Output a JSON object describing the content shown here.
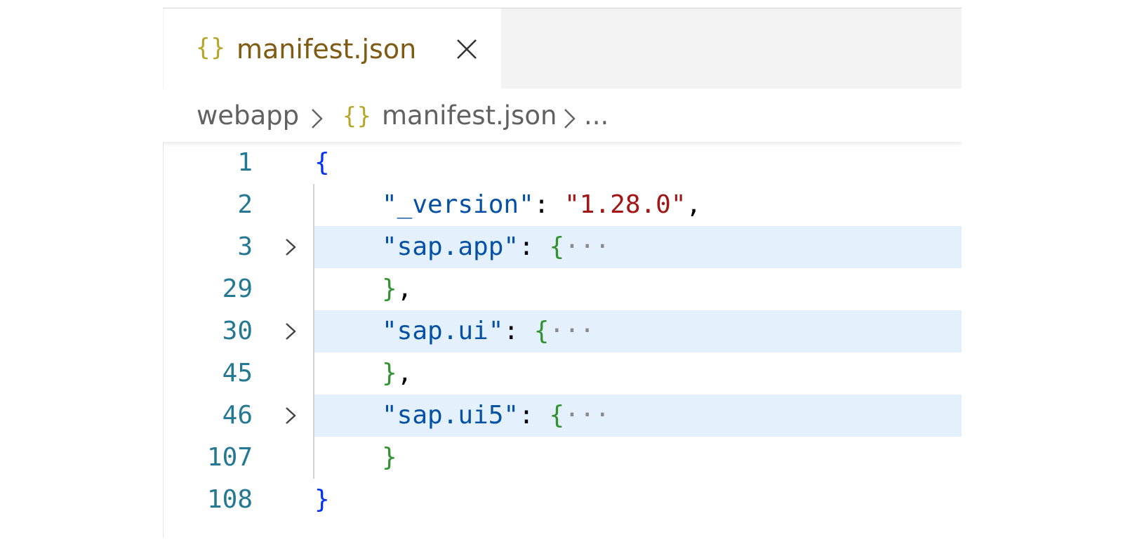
{
  "tab": {
    "icon": "json-braces-icon",
    "icon_text": "{}",
    "label": "manifest.json",
    "close_icon": "close-icon"
  },
  "breadcrumb": {
    "folder": "webapp",
    "file_icon_text": "{}",
    "file": "manifest.json",
    "more": "..."
  },
  "colors": {
    "line_number": "#237893",
    "key": "#0451a5",
    "string": "#a31515",
    "brace_level1": "#0431fa",
    "brace_level2": "#319331",
    "fold_highlight": "#e5f0fd"
  },
  "code": {
    "lines": [
      {
        "number": "1",
        "foldable": false,
        "tokens": {
          "open": "{"
        }
      },
      {
        "number": "2",
        "foldable": false,
        "tokens": {
          "key": "\"_version\"",
          "colon": ":",
          "value": "\"1.28.0\"",
          "comma": ","
        }
      },
      {
        "number": "3",
        "foldable": true,
        "tokens": {
          "key": "\"sap.app\"",
          "colon": ":",
          "brace": "{",
          "ellipsis": "···"
        }
      },
      {
        "number": "29",
        "foldable": false,
        "tokens": {
          "brace": "}",
          "comma": ","
        }
      },
      {
        "number": "30",
        "foldable": true,
        "tokens": {
          "key": "\"sap.ui\"",
          "colon": ":",
          "brace": "{",
          "ellipsis": "···"
        }
      },
      {
        "number": "45",
        "foldable": false,
        "tokens": {
          "brace": "}",
          "comma": ","
        }
      },
      {
        "number": "46",
        "foldable": true,
        "tokens": {
          "key": "\"sap.ui5\"",
          "colon": ":",
          "brace": "{",
          "ellipsis": "···"
        }
      },
      {
        "number": "107",
        "foldable": false,
        "tokens": {
          "brace": "}"
        }
      },
      {
        "number": "108",
        "foldable": false,
        "tokens": {
          "close": "}"
        }
      }
    ]
  }
}
